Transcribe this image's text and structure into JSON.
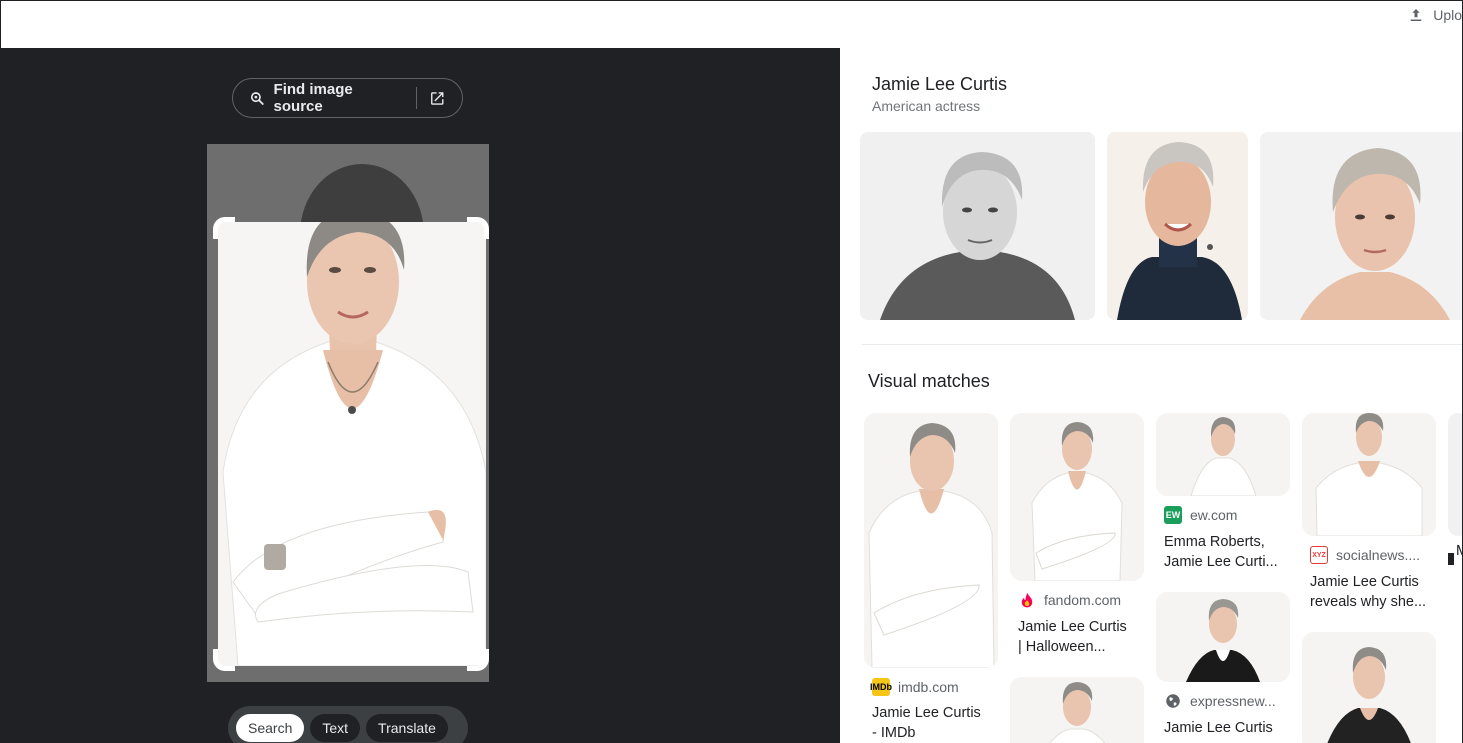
{
  "topbar": {
    "upload_label": "Uplo",
    "upload_icon": "upload-icon"
  },
  "lens": {
    "find_source_label": "Find image source",
    "find_icon": "lens-search-icon",
    "open_icon": "open-in-new-icon",
    "modes": [
      "Search",
      "Text",
      "Translate"
    ],
    "active_mode": "Search"
  },
  "knowledge_panel": {
    "title": "Jamie Lee Curtis",
    "subtitle": "American actress"
  },
  "visual_matches": {
    "heading": "Visual matches",
    "cards": [
      {
        "site": "imdb.com",
        "favicon": "IMDb",
        "favicon_color": "#f5c518",
        "title_line1": "Jamie Lee Curtis",
        "title_line2": "- IMDb"
      },
      {
        "site": "fandom.com",
        "favicon": "fandom-flame-icon",
        "favicon_color": "#fa005a",
        "title_line1": "Jamie Lee Curtis",
        "title_line2": "| Halloween..."
      },
      {
        "site": "ew.com",
        "favicon": "EW",
        "favicon_color": "#1b9e5b",
        "title_line1": "Emma Roberts,",
        "title_line2": "Jamie Lee Curti..."
      },
      {
        "site": "socialnews....",
        "favicon": "XYZ",
        "favicon_color": "#e53935",
        "title_line1": "Jamie Lee Curtis",
        "title_line2": "reveals why she..."
      },
      {
        "site": "expressnew...",
        "favicon": "globe-icon",
        "favicon_color": "#5f6368",
        "title_line1": "Jamie Lee Curtis",
        "title_line2": ""
      }
    ],
    "partial_right_text": "M"
  }
}
